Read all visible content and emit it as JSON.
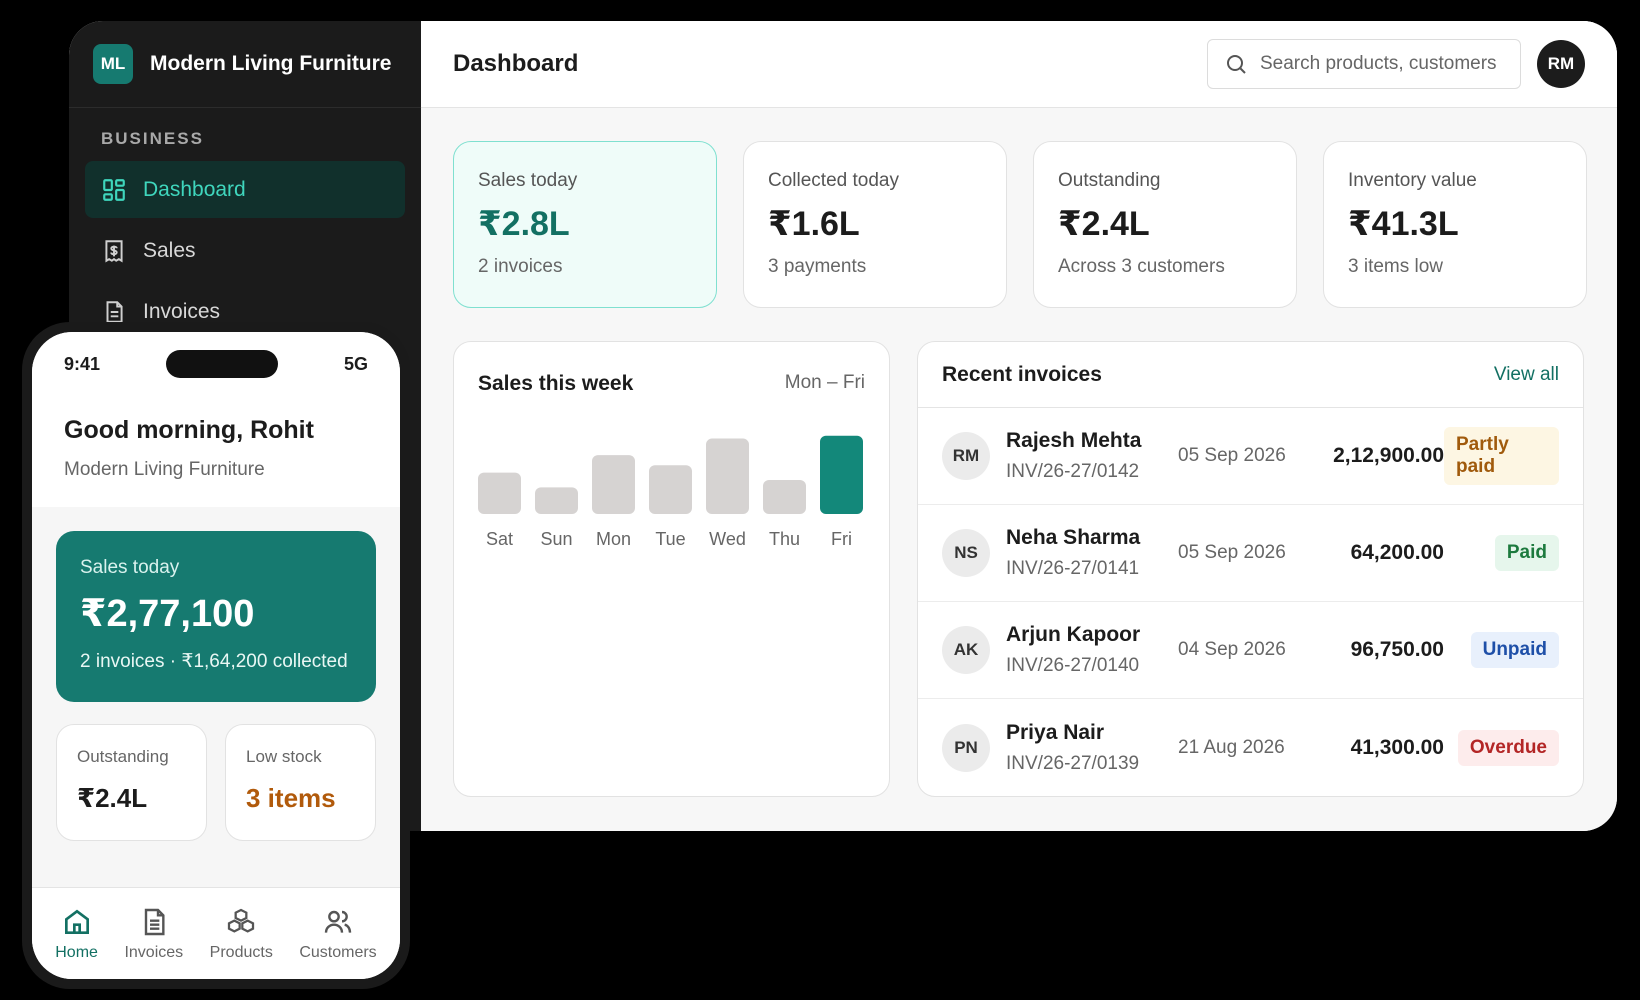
{
  "brand": {
    "logo": "ML",
    "name": "Modern Living Furniture"
  },
  "sidebar": {
    "section": "BUSINESS",
    "items": [
      {
        "label": "Dashboard",
        "icon": "dashboard-icon",
        "active": true
      },
      {
        "label": "Sales",
        "icon": "receipt-icon"
      },
      {
        "label": "Invoices",
        "icon": "document-icon"
      }
    ]
  },
  "header": {
    "title": "Dashboard",
    "search_placeholder": "Search products, customers",
    "avatar": "RM"
  },
  "kpis": [
    {
      "label": "Sales today",
      "value": "₹2.8L",
      "sub": "2 invoices"
    },
    {
      "label": "Collected today",
      "value": "₹1.6L",
      "sub": "3 payments"
    },
    {
      "label": "Outstanding",
      "value": "₹2.4L",
      "sub": "Across 3 customers"
    },
    {
      "label": "Inventory value",
      "value": "₹41.3L",
      "sub": "3 items low"
    }
  ],
  "chart_card": {
    "title": "Sales this week",
    "range": "Mon – Fri"
  },
  "chart_data": {
    "type": "bar",
    "title": "Sales this week",
    "categories": [
      "Sat",
      "Sun",
      "Mon",
      "Tue",
      "Wed",
      "Thu",
      "Fri"
    ],
    "values": [
      45,
      29,
      64,
      53,
      82,
      37,
      85
    ],
    "highlight_index": 6,
    "colors": {
      "bar": "#d6d3d2",
      "highlight": "#13887a"
    },
    "grid": false
  },
  "invoices": {
    "title": "Recent invoices",
    "view_all": "View all",
    "rows": [
      {
        "initials": "RM",
        "name": "Rajesh Mehta",
        "number": "INV/26-27/0142",
        "date": "05 Sep 2026",
        "amount": "2,12,900.00",
        "status": "Partly paid",
        "status_class": "partly"
      },
      {
        "initials": "NS",
        "name": "Neha Sharma",
        "number": "INV/26-27/0141",
        "date": "05 Sep 2026",
        "amount": "64,200.00",
        "status": "Paid",
        "status_class": "paid"
      },
      {
        "initials": "AK",
        "name": "Arjun Kapoor",
        "number": "INV/26-27/0140",
        "date": "04 Sep 2026",
        "amount": "96,750.00",
        "status": "Unpaid",
        "status_class": "unpaid"
      },
      {
        "initials": "PN",
        "name": "Priya Nair",
        "number": "INV/26-27/0139",
        "date": "21 Aug 2026",
        "amount": "41,300.00",
        "status": "Overdue",
        "status_class": "overdue"
      }
    ]
  },
  "phone": {
    "time": "9:41",
    "network": "5G",
    "greeting": "Good morning, Rohit",
    "business": "Modern Living Furniture",
    "sales": {
      "label": "Sales today",
      "value": "₹2,77,100",
      "sub": "2 invoices · ₹1,64,200 collected"
    },
    "minis": [
      {
        "label": "Outstanding",
        "value": "₹2.4L"
      },
      {
        "label": "Low stock",
        "value": "3 items"
      }
    ],
    "tabs": [
      {
        "label": "Home",
        "icon": "home-icon",
        "active": true
      },
      {
        "label": "Invoices",
        "icon": "document-icon"
      },
      {
        "label": "Products",
        "icon": "boxes-icon"
      },
      {
        "label": "Customers",
        "icon": "users-icon"
      }
    ]
  },
  "colors": {
    "accent": "#167a70",
    "accent_light": "#3fd6bd",
    "sidebar_bg": "#1b1b1b"
  }
}
